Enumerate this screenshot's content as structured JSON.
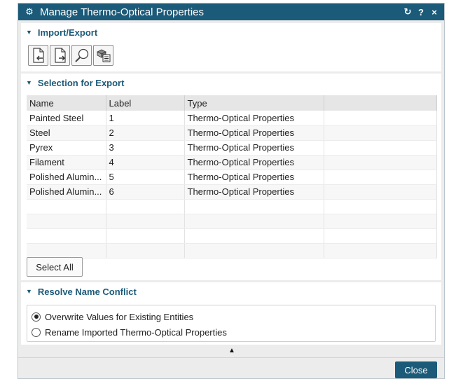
{
  "window": {
    "title": "Manage Thermo-Optical Properties",
    "icon": "gear-icon",
    "actions": [
      "reset-icon",
      "help-icon",
      "close-icon"
    ],
    "reset_glyph": "↻",
    "help_glyph": "?",
    "close_glyph": "×"
  },
  "import_export": {
    "header": "Import/Export",
    "tools": [
      "import-file-icon",
      "export-file-icon",
      "search-icon",
      "database-icon"
    ]
  },
  "selection": {
    "header": "Selection for Export",
    "columns": [
      "Name",
      "Label",
      "Type",
      ""
    ],
    "rows": [
      [
        "Painted Steel",
        "1",
        "Thermo-Optical Properties",
        ""
      ],
      [
        "Steel",
        "2",
        "Thermo-Optical Properties",
        ""
      ],
      [
        "Pyrex",
        "3",
        "Thermo-Optical Properties",
        ""
      ],
      [
        "Filament",
        "4",
        "Thermo-Optical Properties",
        ""
      ],
      [
        "Polished Alumin...",
        "5",
        "Thermo-Optical Properties",
        ""
      ],
      [
        "Polished Alumin...",
        "6",
        "Thermo-Optical Properties",
        ""
      ],
      [
        "",
        "",
        "",
        ""
      ],
      [
        "",
        "",
        "",
        ""
      ],
      [
        "",
        "",
        "",
        ""
      ],
      [
        "",
        "",
        "",
        ""
      ]
    ],
    "select_all_label": "Select All"
  },
  "resolve": {
    "header": "Resolve Name Conflict",
    "options": [
      {
        "label": "Overwrite Values for Existing Entities",
        "selected": true
      },
      {
        "label": "Rename Imported Thermo-Optical Properties",
        "selected": false
      }
    ]
  },
  "footer": {
    "close_label": "Close"
  },
  "colors": {
    "title_bar": "#1b5a78",
    "accent": "#1b5a78"
  }
}
